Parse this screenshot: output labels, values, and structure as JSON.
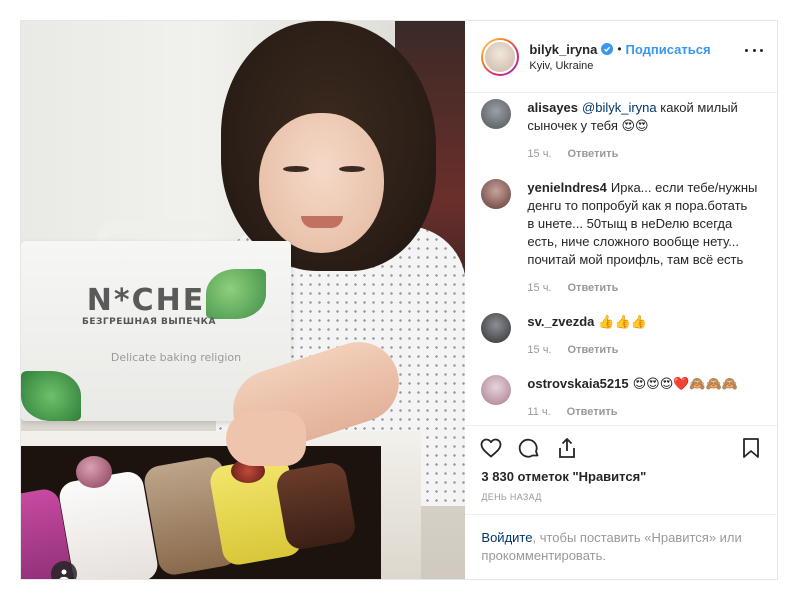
{
  "post": {
    "author": {
      "username": "bilyk_iryna",
      "location": "Kyiv, Ukraine",
      "verified": true,
      "follow_label": "Подписаться",
      "separator": "•"
    },
    "photo": {
      "brand_name": "N*CHE",
      "brand_subtitle": "БЕЗГРЕШНАЯ ВЫПЕЧКА",
      "brand_tagline": "Delicate baking religion"
    },
    "comments": [
      {
        "username": "alisayes",
        "mention": "@bilyk_iryna",
        "text": "какой милый сыночек у тебя 😍😍",
        "time": "15 ч.",
        "reply_label": "Ответить",
        "avatar_color": "#6b6f75"
      },
      {
        "username": "yenielndres4",
        "mention": "",
        "text": "Ирка... если тебе/нужны денгu то попробуй как я пора.ботать в uнете... 50тыщ в неDелю всегда есть, ниче сложного вообще нету... почитай мой проифль, там всё есть",
        "time": "15 ч.",
        "reply_label": "Ответить",
        "avatar_color": "#7a5a58"
      },
      {
        "username": "sv._zvezda",
        "mention": "",
        "text": "👍👍👍",
        "time": "15 ч.",
        "reply_label": "Ответить",
        "avatar_color": "#4c4f52"
      },
      {
        "username": "ostrovskaia5215",
        "mention": "",
        "text": "😍😍😍❤️🙈🙈🙈",
        "time": "11 ч.",
        "reply_label": "Ответить",
        "avatar_color": "#c9a8b6"
      }
    ],
    "likes_text": "3 830 отметок \"Нравится\"",
    "posted_ago": "ДЕНЬ НАЗАД",
    "login_prompt": {
      "link": "Войдите",
      "rest": ", чтобы поставить «Нравится» или прокомментировать."
    },
    "icons": [
      "heart-icon",
      "comment-icon",
      "share-icon",
      "bookmark-icon",
      "more-options-icon",
      "user-tag-icon",
      "verified-badge-icon"
    ],
    "colors": {
      "accent": "#3897f0",
      "text": "#262626",
      "muted": "#999999",
      "border": "#e6e6e6"
    }
  }
}
